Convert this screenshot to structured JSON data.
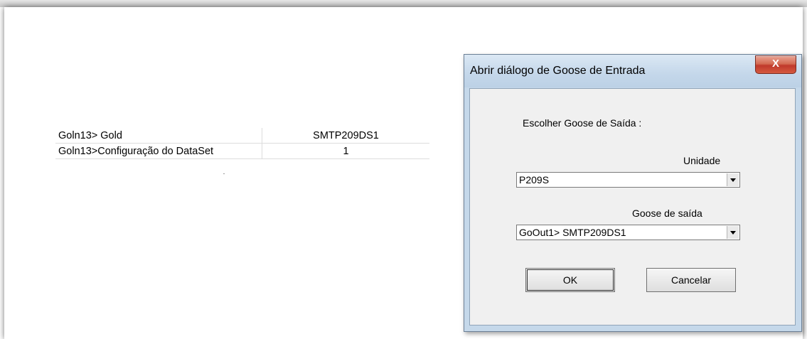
{
  "table": {
    "rows": [
      {
        "key": "Goln13> Gold",
        "value": "SMTP209DS1"
      },
      {
        "key": "Goln13>Configuração do DataSet",
        "value": "1"
      }
    ]
  },
  "dialog": {
    "title": "Abrir diálogo de Goose de Entrada",
    "close_glyph": "X",
    "prompt": "Escolher Goose de Saída :",
    "unidade_label": "Unidade",
    "unidade_value": "P209S",
    "goose_label": "Goose de saída",
    "goose_value": "GoOut1> SMTP209DS1",
    "ok_label": "OK",
    "cancel_label": "Cancelar"
  }
}
